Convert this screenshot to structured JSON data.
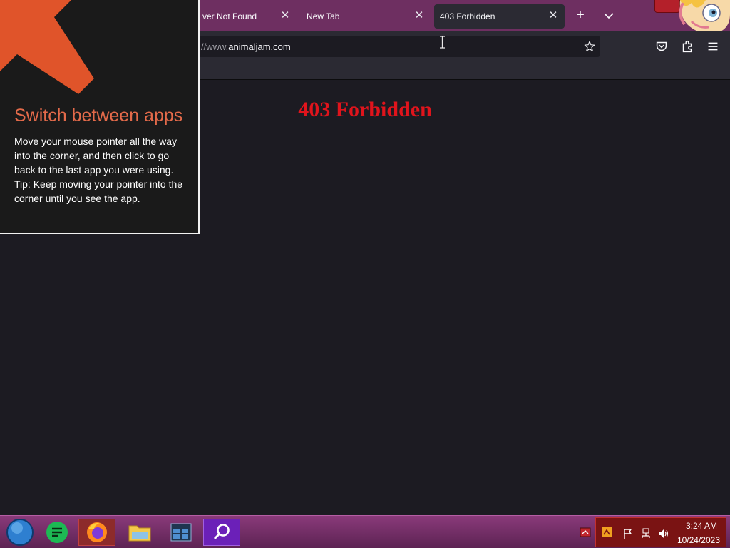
{
  "browser": {
    "tabs": [
      {
        "label": "ver Not Found",
        "close": "✕"
      },
      {
        "label": "New Tab",
        "close": "✕"
      },
      {
        "label": "403 Forbidden",
        "close": "✕",
        "active": true
      }
    ],
    "new_tab": "+",
    "list_tabs": "⌄",
    "url": {
      "prefix": "//www.",
      "domain": "animaljam.com"
    }
  },
  "page": {
    "heading": "403 Forbidden",
    "heading_color": "#e0141c"
  },
  "tip": {
    "title": "Switch between apps",
    "line1": "Move your mouse pointer all the way into the corner, and then click to go back to the last app you were using.",
    "line2": "Tip: Keep moving your pointer into the corner until you see the app.",
    "accent": "#e36a4a"
  },
  "taskbar": {
    "apps": [
      "start-orb-icon",
      "notes-app-icon",
      "firefox-icon",
      "file-explorer-icon",
      "window-manager-icon",
      "search-icon"
    ],
    "time": "3:24 AM",
    "date": "10/24/2023"
  }
}
